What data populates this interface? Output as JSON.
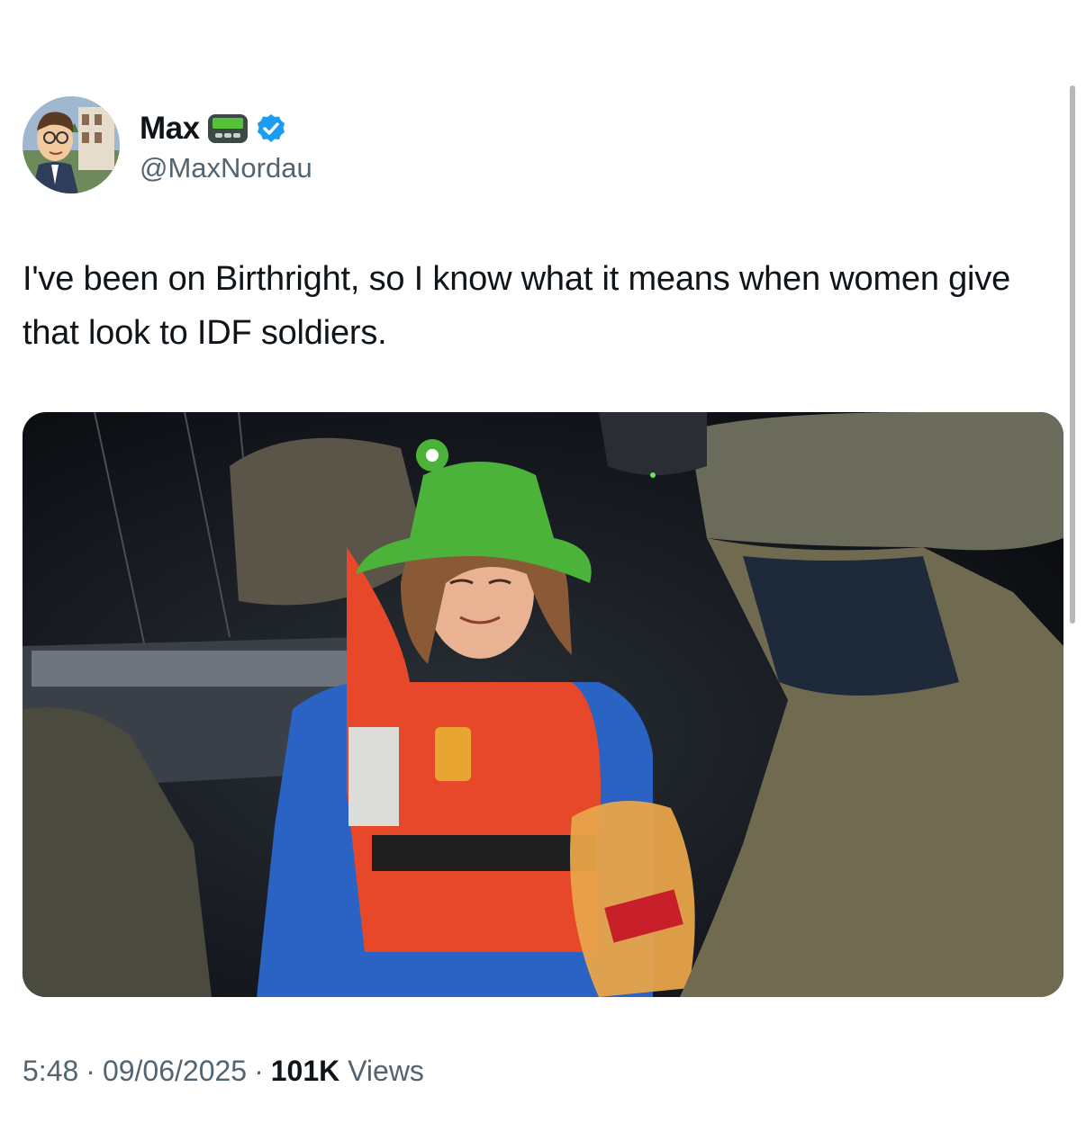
{
  "tweet": {
    "author": {
      "name": "Max",
      "handle": "@MaxNordau",
      "avatar_icon": "cartoon-man-avatar",
      "badges": [
        "pager-icon",
        "verified-icon"
      ],
      "verified_color": "#1d9bf0"
    },
    "text": "I've been on Birthright, so I know what it means when women give that look to IDF soldiers.",
    "media": {
      "type": "photo",
      "alt": ""
    },
    "meta": {
      "time": "5:48",
      "date": "09/06/2025",
      "views_count": "101K",
      "views_label": "Views",
      "separator": "·"
    }
  }
}
